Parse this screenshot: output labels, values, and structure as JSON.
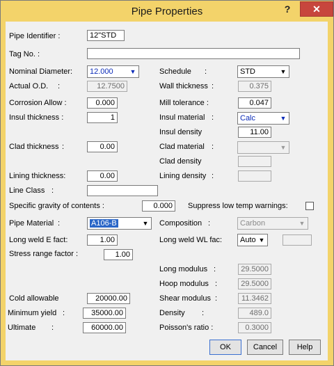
{
  "window": {
    "title": "Pipe Properties",
    "help_glyph": "?",
    "close_glyph": "✕"
  },
  "labels": {
    "pipe_identifier": "Pipe Identifier :",
    "tag_no": "Tag No. :",
    "nominal_diameter": "Nominal Diameter:",
    "actual_od": "Actual O.D.",
    "colon": ":",
    "corrosion_allow": "Corrosion Allow :",
    "insul_thickness": "Insul thickness :",
    "clad_thickness": "Clad thickness",
    "lining_thickness": "Lining thickness:",
    "line_class": "Line Class",
    "specific_gravity": "Specific gravity of contents :",
    "suppress_low_temp": "Suppress low temp warnings:",
    "pipe_material": "Pipe Material",
    "long_weld_e_fact": "Long weld E fact:",
    "stress_range_factor": "Stress range factor :",
    "cold_allowable": "Cold allowable",
    "minimum_yield": "Minimum yield",
    "ultimate": "Ultimate",
    "schedule": "Schedule",
    "wall_thickness": "Wall thickness",
    "mill_tolerance": "Mill tolerance :",
    "insul_material": "Insul material",
    "insul_density": "Insul density",
    "clad_material": "Clad material",
    "clad_density": "Clad density",
    "lining_density": "Lining density",
    "composition": "Composition",
    "long_weld_wl_fac": "Long weld WL fac:",
    "long_modulus": "Long modulus",
    "hoop_modulus": "Hoop modulus",
    "shear_modulus": "Shear modulus",
    "density": "Density",
    "poissons_ratio": "Poisson's ratio :"
  },
  "values": {
    "pipe_identifier": "12\"STD",
    "tag_no": "",
    "nominal_diameter": "12.000",
    "actual_od": "12.7500",
    "corrosion_allow": "0.000",
    "insul_thickness": "1",
    "clad_thickness": "0.00",
    "lining_thickness": "0.00",
    "line_class": "",
    "specific_gravity": "0.000",
    "pipe_material": "A106-B",
    "long_weld_e_fact": "1.00",
    "stress_range_factor": "1.00",
    "cold_allowable": "20000.00",
    "minimum_yield": "35000.00",
    "ultimate": "60000.00",
    "schedule": "STD",
    "wall_thickness": "0.375",
    "mill_tolerance": "0.047",
    "insul_material": "Calc",
    "insul_density": "11.00",
    "clad_material": "",
    "clad_density": "",
    "lining_density": "",
    "composition": "Carbon",
    "long_weld_wl_fac": "Auto",
    "long_weld_wl_value": "",
    "long_modulus": "29.5000",
    "hoop_modulus": "29.5000",
    "shear_modulus": "11.3462",
    "density": "489.0",
    "poissons_ratio": "0.3000",
    "suppress_low_temp_checked": false
  },
  "buttons": {
    "ok": "OK",
    "cancel": "Cancel",
    "help": "Help"
  },
  "dropdown_arrow": "▼"
}
